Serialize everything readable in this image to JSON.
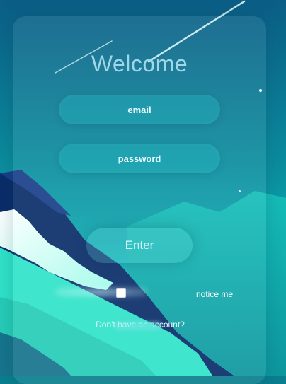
{
  "login": {
    "title": "Welcome",
    "email_placeholder": "email",
    "password_placeholder": "password",
    "enter_label": "Enter",
    "remember_label": "notice me",
    "signup_text": "Don't have an account?"
  },
  "colors": {
    "sky_top": "#0b5e86",
    "sky_bottom": "#16d6cf",
    "mountain_dark": "#0a2d6a",
    "mountain_teal": "#2fe3c8"
  },
  "icons": {
    "checkbox": "checkbox-icon"
  }
}
